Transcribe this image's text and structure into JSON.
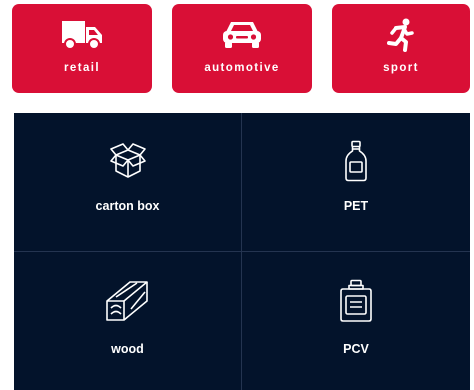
{
  "industries": [
    {
      "label": "retail",
      "icon": "truck-icon"
    },
    {
      "label": "automotive",
      "icon": "car-icon"
    },
    {
      "label": "sport",
      "icon": "runner-icon"
    }
  ],
  "materials": [
    {
      "label": "carton box",
      "icon": "carton-box-icon"
    },
    {
      "label": "PET",
      "icon": "pet-bottle-icon"
    },
    {
      "label": "wood",
      "icon": "wood-plank-icon"
    },
    {
      "label": "PCV",
      "icon": "canister-icon"
    }
  ],
  "colors": {
    "accent": "#d90f36",
    "panel_background": "#03132b",
    "divider": "#243450",
    "text_on_dark": "#ffffff"
  }
}
